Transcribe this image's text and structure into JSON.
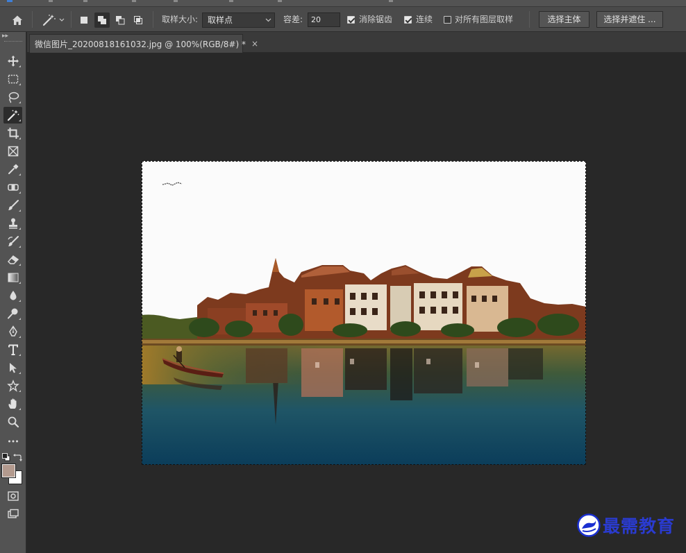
{
  "options": {
    "sample_size_label": "取样大小:",
    "sample_size_value": "取样点",
    "tolerance_label": "容差:",
    "tolerance_value": "20",
    "anti_alias_label": "消除锯齿",
    "contiguous_label": "连续",
    "sample_all_layers_label": "对所有图层取样",
    "select_subject_label": "选择主体",
    "select_mask_label": "选择并遮住 ..."
  },
  "document": {
    "tab_title": "微信图片_20200818161032.jpg @ 100%(RGB/8#) *",
    "close_glyph": "×"
  },
  "watermark": {
    "text": "最需教育"
  },
  "colors": {
    "foreground": "#b39a8e",
    "background": "#ffffff"
  }
}
